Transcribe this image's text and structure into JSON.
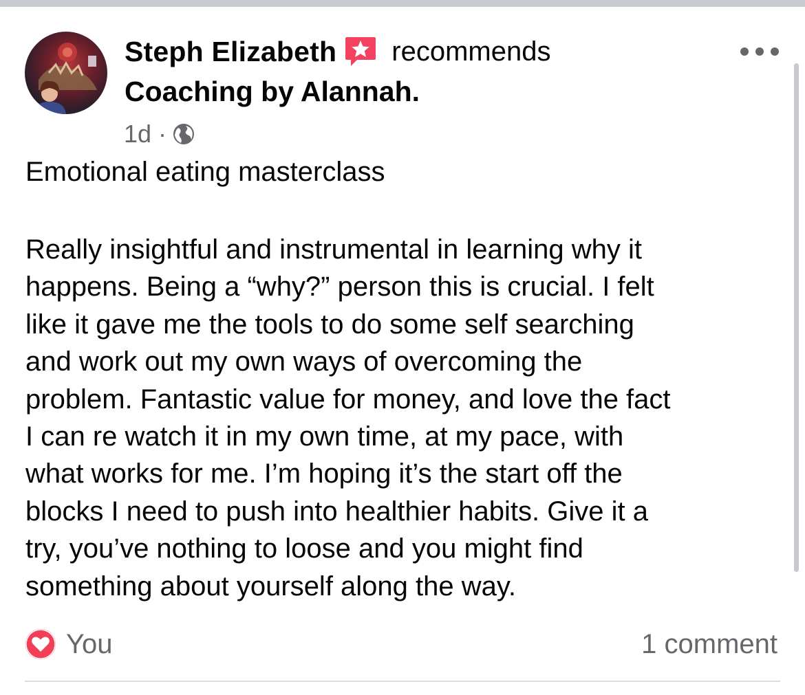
{
  "post": {
    "author": "Steph Elizabeth",
    "action": "recommends",
    "page_name": "Coaching by Alannah.",
    "timestamp": "1d",
    "separator": "·",
    "title": "Emotional eating masterclass",
    "body_lines": [
      "Really insightful and instrumental in learning why it",
      "happens. Being a “why?” person this is crucial. I felt",
      "like it gave me the tools to do some self searching",
      "and work out my own ways of overcoming the",
      "problem. Fantastic value for money, and love the fact",
      "I can re watch it in my own time, at my pace, with",
      "what works for me. I’m hoping it’s the start off the",
      "blocks I need to push into healthier habits. Give it a",
      "try, you’ve nothing to loose and you might find",
      "something about yourself along the way."
    ]
  },
  "footer": {
    "reaction_by": "You",
    "comments_label": "1 comment"
  },
  "icons": {
    "avatar": "profile-photo",
    "badge": "recommendation-star-icon",
    "audience": "globe-icon",
    "menu": "more-options-icon",
    "reaction": "heart-reaction-icon"
  },
  "colors": {
    "text": "#050505",
    "secondary_text": "#65676b",
    "badge": "#f3425f",
    "heart": "#f33e58",
    "divider": "#dadde1"
  }
}
